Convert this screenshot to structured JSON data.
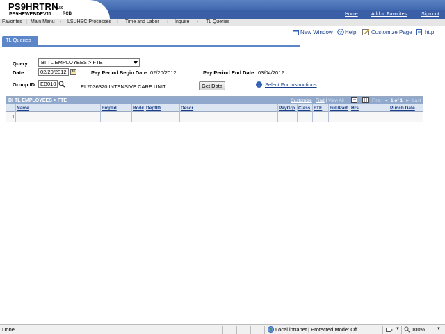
{
  "header": {
    "app_title": "PS9HRTRN",
    "version": "8.50",
    "database": "PS9HEWEBDEV11",
    "user": "RCB",
    "links": [
      "Home",
      "Add to Favorites",
      "Sign out"
    ]
  },
  "nav": {
    "items": [
      "Favorites",
      "Main Menu",
      "LSUHSC Processes",
      "Time and Labor",
      "Inquire",
      "TL Queries"
    ],
    "separator": "›"
  },
  "toolbar": {
    "new_window": "New Window",
    "help": "Help",
    "customize_page": "Customize Page",
    "http": "http"
  },
  "tab": {
    "label": "TL Queries"
  },
  "form": {
    "query_label": "Query:",
    "query_value": "BI TL EMPLOYEES > FTE",
    "date_label": "Date:",
    "date_value": "02/20/2012",
    "calendar_glyph": "31",
    "begin_label": "Pay Period Begin Date:",
    "begin_value": "02/20/2012",
    "end_label": "Pay Period End Date:",
    "end_value": "03/04/2012",
    "group_label": "Group ID:",
    "group_value": "EB010",
    "group_desc": "EL2036320 INTENSIVE CARE UNIT",
    "get_data": "Get Data",
    "instructions": "Select For Instructions"
  },
  "grid": {
    "title": "BI TL EMPLOYEES > FTE",
    "customize": "Customize",
    "find": "Find",
    "view_all": "View All",
    "first": "First",
    "page_info": "1 of 1",
    "last": "Last",
    "columns": [
      "Name",
      "Emplid",
      "Rcd#",
      "DeptID",
      "Descr",
      "PayGrp",
      "Class",
      "FTE",
      "Full/Part",
      "Hrs",
      "Punch Date"
    ],
    "row_number": "1"
  },
  "statusbar": {
    "left": "Done",
    "zone": "Local intranet | Protected Mode: Off",
    "zoom": "100%"
  }
}
